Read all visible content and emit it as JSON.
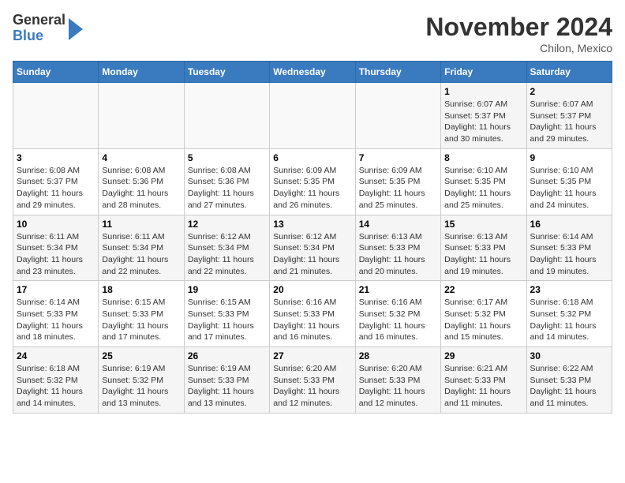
{
  "header": {
    "logo_line1": "General",
    "logo_line2": "Blue",
    "title": "November 2024",
    "subtitle": "Chilon, Mexico"
  },
  "days_of_week": [
    "Sunday",
    "Monday",
    "Tuesday",
    "Wednesday",
    "Thursday",
    "Friday",
    "Saturday"
  ],
  "weeks": [
    [
      {
        "day": "",
        "info": ""
      },
      {
        "day": "",
        "info": ""
      },
      {
        "day": "",
        "info": ""
      },
      {
        "day": "",
        "info": ""
      },
      {
        "day": "",
        "info": ""
      },
      {
        "day": "1",
        "info": "Sunrise: 6:07 AM\nSunset: 5:37 PM\nDaylight: 11 hours and 30 minutes."
      },
      {
        "day": "2",
        "info": "Sunrise: 6:07 AM\nSunset: 5:37 PM\nDaylight: 11 hours and 29 minutes."
      }
    ],
    [
      {
        "day": "3",
        "info": "Sunrise: 6:08 AM\nSunset: 5:37 PM\nDaylight: 11 hours and 29 minutes."
      },
      {
        "day": "4",
        "info": "Sunrise: 6:08 AM\nSunset: 5:36 PM\nDaylight: 11 hours and 28 minutes."
      },
      {
        "day": "5",
        "info": "Sunrise: 6:08 AM\nSunset: 5:36 PM\nDaylight: 11 hours and 27 minutes."
      },
      {
        "day": "6",
        "info": "Sunrise: 6:09 AM\nSunset: 5:35 PM\nDaylight: 11 hours and 26 minutes."
      },
      {
        "day": "7",
        "info": "Sunrise: 6:09 AM\nSunset: 5:35 PM\nDaylight: 11 hours and 25 minutes."
      },
      {
        "day": "8",
        "info": "Sunrise: 6:10 AM\nSunset: 5:35 PM\nDaylight: 11 hours and 25 minutes."
      },
      {
        "day": "9",
        "info": "Sunrise: 6:10 AM\nSunset: 5:35 PM\nDaylight: 11 hours and 24 minutes."
      }
    ],
    [
      {
        "day": "10",
        "info": "Sunrise: 6:11 AM\nSunset: 5:34 PM\nDaylight: 11 hours and 23 minutes."
      },
      {
        "day": "11",
        "info": "Sunrise: 6:11 AM\nSunset: 5:34 PM\nDaylight: 11 hours and 22 minutes."
      },
      {
        "day": "12",
        "info": "Sunrise: 6:12 AM\nSunset: 5:34 PM\nDaylight: 11 hours and 22 minutes."
      },
      {
        "day": "13",
        "info": "Sunrise: 6:12 AM\nSunset: 5:34 PM\nDaylight: 11 hours and 21 minutes."
      },
      {
        "day": "14",
        "info": "Sunrise: 6:13 AM\nSunset: 5:33 PM\nDaylight: 11 hours and 20 minutes."
      },
      {
        "day": "15",
        "info": "Sunrise: 6:13 AM\nSunset: 5:33 PM\nDaylight: 11 hours and 19 minutes."
      },
      {
        "day": "16",
        "info": "Sunrise: 6:14 AM\nSunset: 5:33 PM\nDaylight: 11 hours and 19 minutes."
      }
    ],
    [
      {
        "day": "17",
        "info": "Sunrise: 6:14 AM\nSunset: 5:33 PM\nDaylight: 11 hours and 18 minutes."
      },
      {
        "day": "18",
        "info": "Sunrise: 6:15 AM\nSunset: 5:33 PM\nDaylight: 11 hours and 17 minutes."
      },
      {
        "day": "19",
        "info": "Sunrise: 6:15 AM\nSunset: 5:33 PM\nDaylight: 11 hours and 17 minutes."
      },
      {
        "day": "20",
        "info": "Sunrise: 6:16 AM\nSunset: 5:33 PM\nDaylight: 11 hours and 16 minutes."
      },
      {
        "day": "21",
        "info": "Sunrise: 6:16 AM\nSunset: 5:32 PM\nDaylight: 11 hours and 16 minutes."
      },
      {
        "day": "22",
        "info": "Sunrise: 6:17 AM\nSunset: 5:32 PM\nDaylight: 11 hours and 15 minutes."
      },
      {
        "day": "23",
        "info": "Sunrise: 6:18 AM\nSunset: 5:32 PM\nDaylight: 11 hours and 14 minutes."
      }
    ],
    [
      {
        "day": "24",
        "info": "Sunrise: 6:18 AM\nSunset: 5:32 PM\nDaylight: 11 hours and 14 minutes."
      },
      {
        "day": "25",
        "info": "Sunrise: 6:19 AM\nSunset: 5:32 PM\nDaylight: 11 hours and 13 minutes."
      },
      {
        "day": "26",
        "info": "Sunrise: 6:19 AM\nSunset: 5:33 PM\nDaylight: 11 hours and 13 minutes."
      },
      {
        "day": "27",
        "info": "Sunrise: 6:20 AM\nSunset: 5:33 PM\nDaylight: 11 hours and 12 minutes."
      },
      {
        "day": "28",
        "info": "Sunrise: 6:20 AM\nSunset: 5:33 PM\nDaylight: 11 hours and 12 minutes."
      },
      {
        "day": "29",
        "info": "Sunrise: 6:21 AM\nSunset: 5:33 PM\nDaylight: 11 hours and 11 minutes."
      },
      {
        "day": "30",
        "info": "Sunrise: 6:22 AM\nSunset: 5:33 PM\nDaylight: 11 hours and 11 minutes."
      }
    ]
  ]
}
